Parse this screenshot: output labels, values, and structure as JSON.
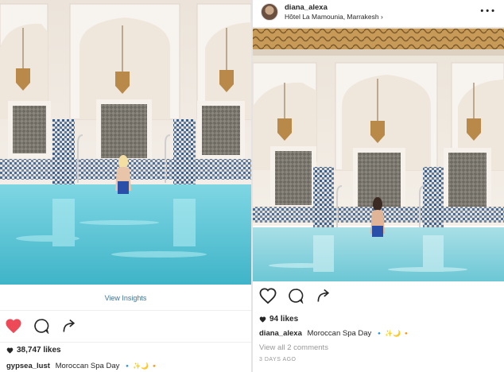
{
  "left_post": {
    "insights_link": "View Insights",
    "likes": "38,747 likes",
    "caption_username": "gypsea_lust",
    "caption_text": "Moroccan Spa Day",
    "caption_emojis": "🔹 ✨🌙 🔸"
  },
  "right_post": {
    "username": "diana_alexa",
    "location": "Hôtel La Mamounia, Marrakesh",
    "location_chevron": "›",
    "more_dots": "• • •",
    "likes": "94 likes",
    "caption_username": "diana_alexa",
    "caption_text": "Moroccan Spa Day",
    "caption_emojis": "🔹 ✨🌙 🔸",
    "comments_link": "View all 2 comments",
    "time_ago": "3 DAYS AGO"
  },
  "icons": {
    "left_like": "heart-filled-icon",
    "like": "heart-outline-icon",
    "comment": "comment-icon",
    "share": "share-icon",
    "likes_heart": "small-heart-icon"
  },
  "colors": {
    "like_red": "#ed4956",
    "link_blue": "#3f729b",
    "pool": "#5cc4d6",
    "gray_text": "#999999"
  }
}
